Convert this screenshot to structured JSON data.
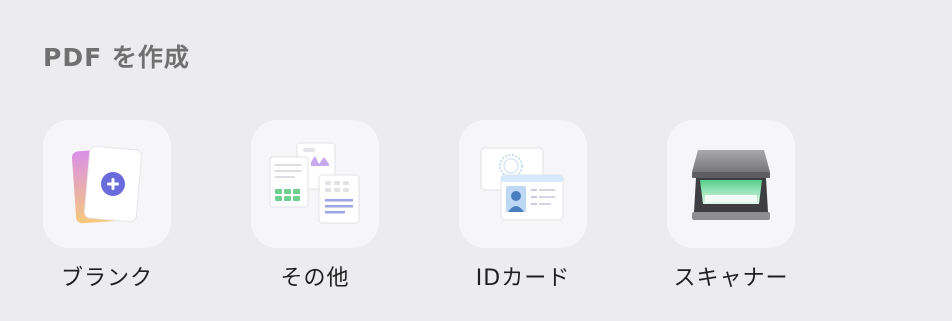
{
  "section": {
    "title": "PDF を作成"
  },
  "items": [
    {
      "label": "ブランク",
      "icon": "blank-document-plus-icon"
    },
    {
      "label": "その他",
      "icon": "other-documents-icon"
    },
    {
      "label": "IDカード",
      "icon": "id-card-icon"
    },
    {
      "label": "スキャナー",
      "icon": "scanner-icon"
    }
  ],
  "colors": {
    "background": "#ececee",
    "tile": "#f6f6f8",
    "accent": "#6b6cdc"
  }
}
